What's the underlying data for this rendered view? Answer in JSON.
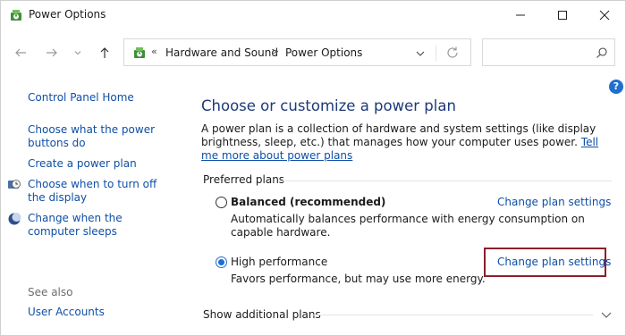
{
  "window": {
    "title": "Power Options"
  },
  "titlebar": {
    "icons": [
      "power-options-icon",
      "minimize-icon",
      "maximize-icon",
      "close-icon"
    ]
  },
  "nav": {
    "back_icon": "arrow-left-icon",
    "forward_icon": "arrow-right-icon",
    "recent_icon": "chevron-down-icon",
    "up_icon": "arrow-up-icon"
  },
  "address": {
    "overflow": "«",
    "crumbs": [
      "Hardware and Sound",
      "Power Options"
    ],
    "separator": ">"
  },
  "search": {
    "placeholder": ""
  },
  "sidebar": {
    "items": [
      {
        "label": "Control Panel Home"
      },
      {
        "label": "Choose what the power buttons do"
      },
      {
        "label": "Create a power plan"
      },
      {
        "label": "Choose when to turn off the display",
        "icon": "display-timer-icon"
      },
      {
        "label": "Change when the computer sleeps",
        "icon": "sleep-moon-icon"
      }
    ],
    "see_also": "See also",
    "see_also_items": [
      {
        "label": "User Accounts"
      }
    ]
  },
  "main": {
    "heading": "Choose or customize a power plan",
    "description": "A power plan is a collection of hardware and system settings (like display brightness, sleep, etc.) that manages how your computer uses power.",
    "learn_more": "Tell me more about power plans",
    "preferred_label": "Preferred plans",
    "plans": [
      {
        "name": "Balanced (recommended)",
        "description": "Automatically balances performance with energy consumption on capable hardware.",
        "selected": false,
        "change_label": "Change plan settings"
      },
      {
        "name": "High performance",
        "description": "Favors performance, but may use more energy.",
        "selected": true,
        "change_label": "Change plan settings"
      }
    ],
    "additional_label": "Show additional plans"
  },
  "help": {
    "label": "?"
  },
  "colors": {
    "link": "#0f4fa6",
    "heading": "#1e3a78",
    "accent": "#1f6fd1",
    "highlight_box": "#8c1f2b"
  }
}
